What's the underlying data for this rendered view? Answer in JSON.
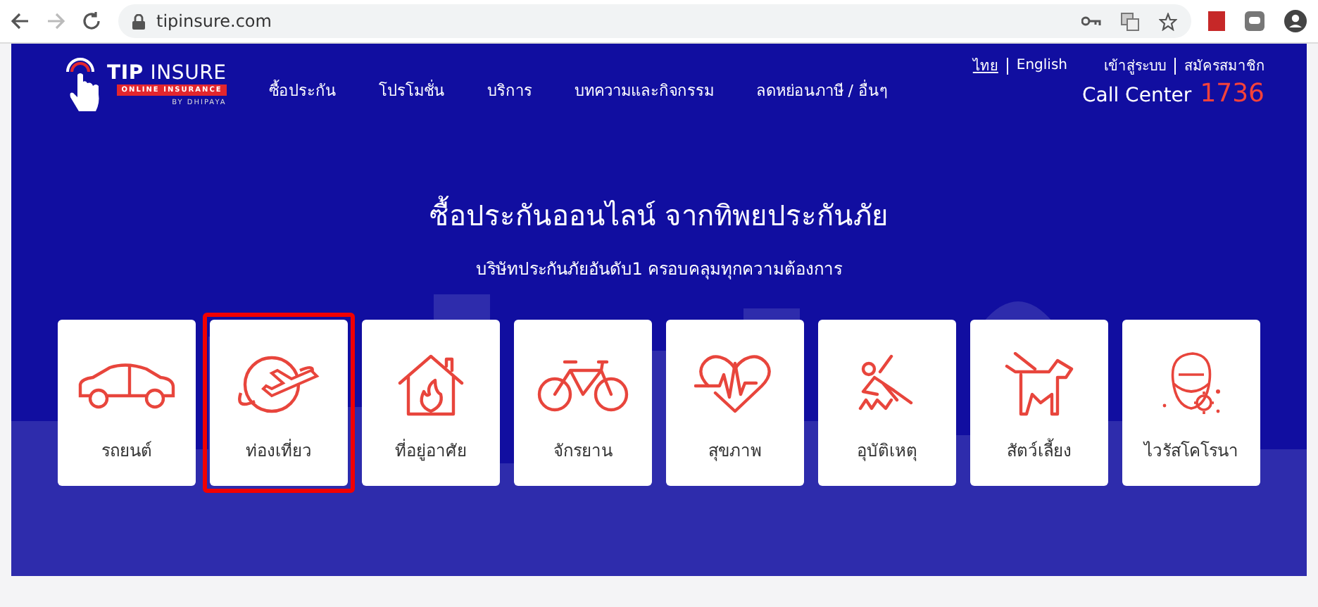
{
  "browser": {
    "url": "tipinsure.com"
  },
  "logo": {
    "name_bold": "TIP",
    "name_rest": "INSURE",
    "tagline": "ONLINE INSURANCE",
    "by": "BY DHIPAYA"
  },
  "languages": [
    {
      "label": "ไทย",
      "selected": true
    },
    {
      "label": "English",
      "selected": false
    }
  ],
  "account_links": [
    "เข้าสู่ระบบ",
    "สมัครสมาชิก"
  ],
  "nav": [
    "ซื้อประกัน",
    "โปรโมชั่น",
    "บริการ",
    "บทความและกิจกรรม",
    "ลดหย่อนภาษี / อื่นๆ"
  ],
  "call_center": {
    "label": "Call Center",
    "number": "1736"
  },
  "hero": {
    "title": "ซื้อประกันออนไลน์ จากทิพยประกันภัย",
    "subtitle": "บริษัทประกันภัยอันดับ1 ครอบคลุมทุกความต้องการ"
  },
  "categories": [
    {
      "label": "รถยนต์",
      "kind": "car",
      "selected": false
    },
    {
      "label": "ท่องเที่ยว",
      "kind": "plane",
      "selected": true
    },
    {
      "label": "ที่อยู่อาศัย",
      "kind": "house",
      "selected": false
    },
    {
      "label": "จักรยาน",
      "kind": "bicycle",
      "selected": false
    },
    {
      "label": "สุขภาพ",
      "kind": "heart",
      "selected": false
    },
    {
      "label": "อุบัติเหตุ",
      "kind": "fall",
      "selected": false
    },
    {
      "label": "สัตว์เลี้ยง",
      "kind": "dog",
      "selected": false
    },
    {
      "label": "ไวรัสโคโรนา",
      "kind": "virus",
      "selected": false
    }
  ]
}
